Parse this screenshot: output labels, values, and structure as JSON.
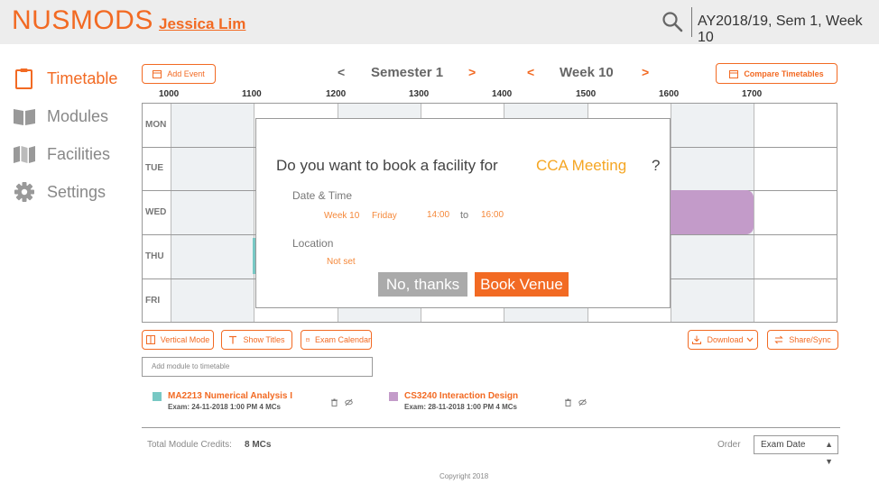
{
  "header": {
    "brand": "NUSMODS",
    "user": "Jessica Lim",
    "semester_label": "AY2018/19, Sem 1, Week 10"
  },
  "sidebar": {
    "items": [
      {
        "label": "Timetable",
        "icon": "clipboard-icon",
        "active": true
      },
      {
        "label": "Modules",
        "icon": "book-icon",
        "active": false
      },
      {
        "label": "Facilities",
        "icon": "map-icon",
        "active": false
      },
      {
        "label": "Settings",
        "icon": "gear-icon",
        "active": false
      }
    ]
  },
  "toolbar": {
    "add_event": "Add Event",
    "semester": "Semester 1",
    "week": "Week 10",
    "prev_arrow": "<",
    "next_arrow": ">",
    "compare": "Compare Timetables"
  },
  "timetable": {
    "hours": [
      "1000",
      "1100",
      "1200",
      "1300",
      "1400",
      "1500",
      "1600",
      "1700"
    ],
    "days": [
      "MON",
      "TUE",
      "WED",
      "THU",
      "FRI"
    ]
  },
  "modal": {
    "question": "Do you want to book a facility for",
    "event_name": "CCA Meeting",
    "question_mark": "?",
    "datetime_label": "Date & Time",
    "week": "Week 10",
    "day": "Friday",
    "start": "14:00",
    "to": "to",
    "end": "16:00",
    "location_label": "Location",
    "location_value": "Not set",
    "cancel": "No, thanks",
    "confirm": "Book Venue"
  },
  "actions": {
    "vertical_mode": "Vertical Mode",
    "show_titles": "Show Titles",
    "exam_calendar": "Exam Calendar",
    "download": "Download",
    "share": "Share/Sync"
  },
  "add_module_placeholder": "Add module to timetable",
  "modules": [
    {
      "title": "MA2213 Numerical Analysis I",
      "details": "Exam: 24-11-2018 1:00 PM   4 MCs",
      "color": "#78c8c4"
    },
    {
      "title": "CS3240 Interaction Design",
      "details": "Exam: 28-11-2018 1:00 PM   4 MCs",
      "color": "#c39bc9"
    }
  ],
  "footer": {
    "credits_label": "Total Module Credits:",
    "credits_value": "8 MCs",
    "order_label": "Order",
    "order_value": "Exam Date",
    "copyright": "Copyright 2018"
  },
  "colors": {
    "accent": "#f26a23",
    "event_highlight": "#f5a623"
  }
}
